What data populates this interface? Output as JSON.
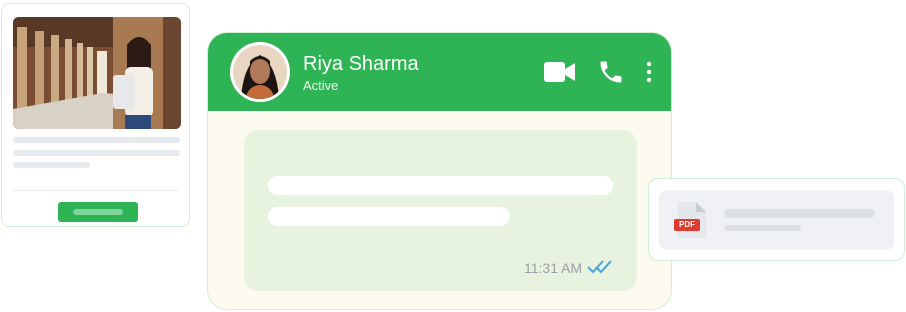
{
  "chat": {
    "contact": {
      "name": "Riya Sharma",
      "status": "Active"
    },
    "header_icons": [
      "video-call-icon",
      "phone-call-icon",
      "more-options-icon"
    ],
    "message": {
      "time": "11:31 AM",
      "read_receipt": "double-check-icon"
    }
  },
  "attachment": {
    "file_type": "PDF"
  },
  "colors": {
    "brand_green": "#2fb455",
    "bubble": "#e7f3de",
    "chat_bg": "#fdfaf0",
    "read_tick": "#4aa3df"
  }
}
